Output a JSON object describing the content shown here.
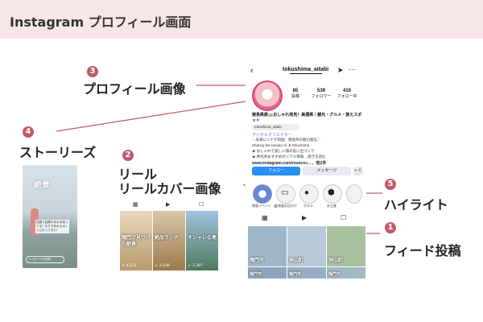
{
  "header": {
    "title": "Instagram プロフィール画面"
  },
  "annotations": [
    {
      "id": "profile_image",
      "num": "3",
      "label": "プロフィール画像"
    },
    {
      "id": "stories",
      "num": "4",
      "label": "ストーリーズ"
    },
    {
      "id": "reels",
      "num": "2",
      "label_line1": "リール",
      "label_line2": "リールカバー画像"
    },
    {
      "id": "highlights",
      "num": "5",
      "label": "ハイライト"
    },
    {
      "id": "feed",
      "num": "1",
      "label": "フィード投稿"
    }
  ],
  "profile": {
    "username": "tokushima_aitabi",
    "stats": [
      {
        "value": "85",
        "label": "投稿"
      },
      {
        "value": "539",
        "label": "フォロワー"
      },
      {
        "value": "419",
        "label": "フォロー中"
      }
    ],
    "bio_name": "徳島県鉄🚃おしゃれ発見！美選県｜観光・グルメ・旅えスポット",
    "threads_handle": "tokushima_aitabi",
    "category": "デジタルクリエイター",
    "bio_lines": [
      "＼未来にツナグ四国：徳島県の魅力発信／",
      "Sharing the beauty of 🇯🇵Tokushima",
      "★ おしゃれで美しい旅の思い出づくり",
      "★ 神兄県おすすめのリアル情報... 続きを読む"
    ],
    "link": "www.instagram.com/rosecoc... 、他2件",
    "buttons": {
      "follow": "フォロー",
      "message": "メッセージ",
      "add": "+ 人"
    }
  },
  "highlights": [
    {
      "label": "徳島イベント"
    },
    {
      "label": "🏯徳島お出かけ"
    },
    {
      "label": "グルメ"
    },
    {
      "label": "お土産"
    },
    {
      "label": ""
    }
  ],
  "feed_posts": [
    {
      "caption": "鳴門市"
    },
    {
      "caption": "神山町"
    },
    {
      "caption": "神山町"
    },
    {
      "caption": "鳴門市"
    },
    {
      "caption": "鳴門市"
    },
    {
      "caption": "鳴門市"
    }
  ],
  "story": {
    "title": "絶景",
    "caption": "四国で話題のあれを知ってる？おすすめのスポットに行ってきた！",
    "input_placeholder": "メッセージを送信"
  },
  "reels": [
    {
      "caption": "鳴門で見つけた絶景",
      "views": "▷ 4,521"
    },
    {
      "caption": "絶品ランチ",
      "views": "▷ 2,108"
    },
    {
      "caption": "オシャレな島",
      "views": "▷ 1,387"
    }
  ],
  "colors": {
    "header_bg": "#f7e6e6",
    "badge": "#c25a6a",
    "highlight_box": "#c25a6a",
    "follow_button": "#2a8ff2"
  }
}
